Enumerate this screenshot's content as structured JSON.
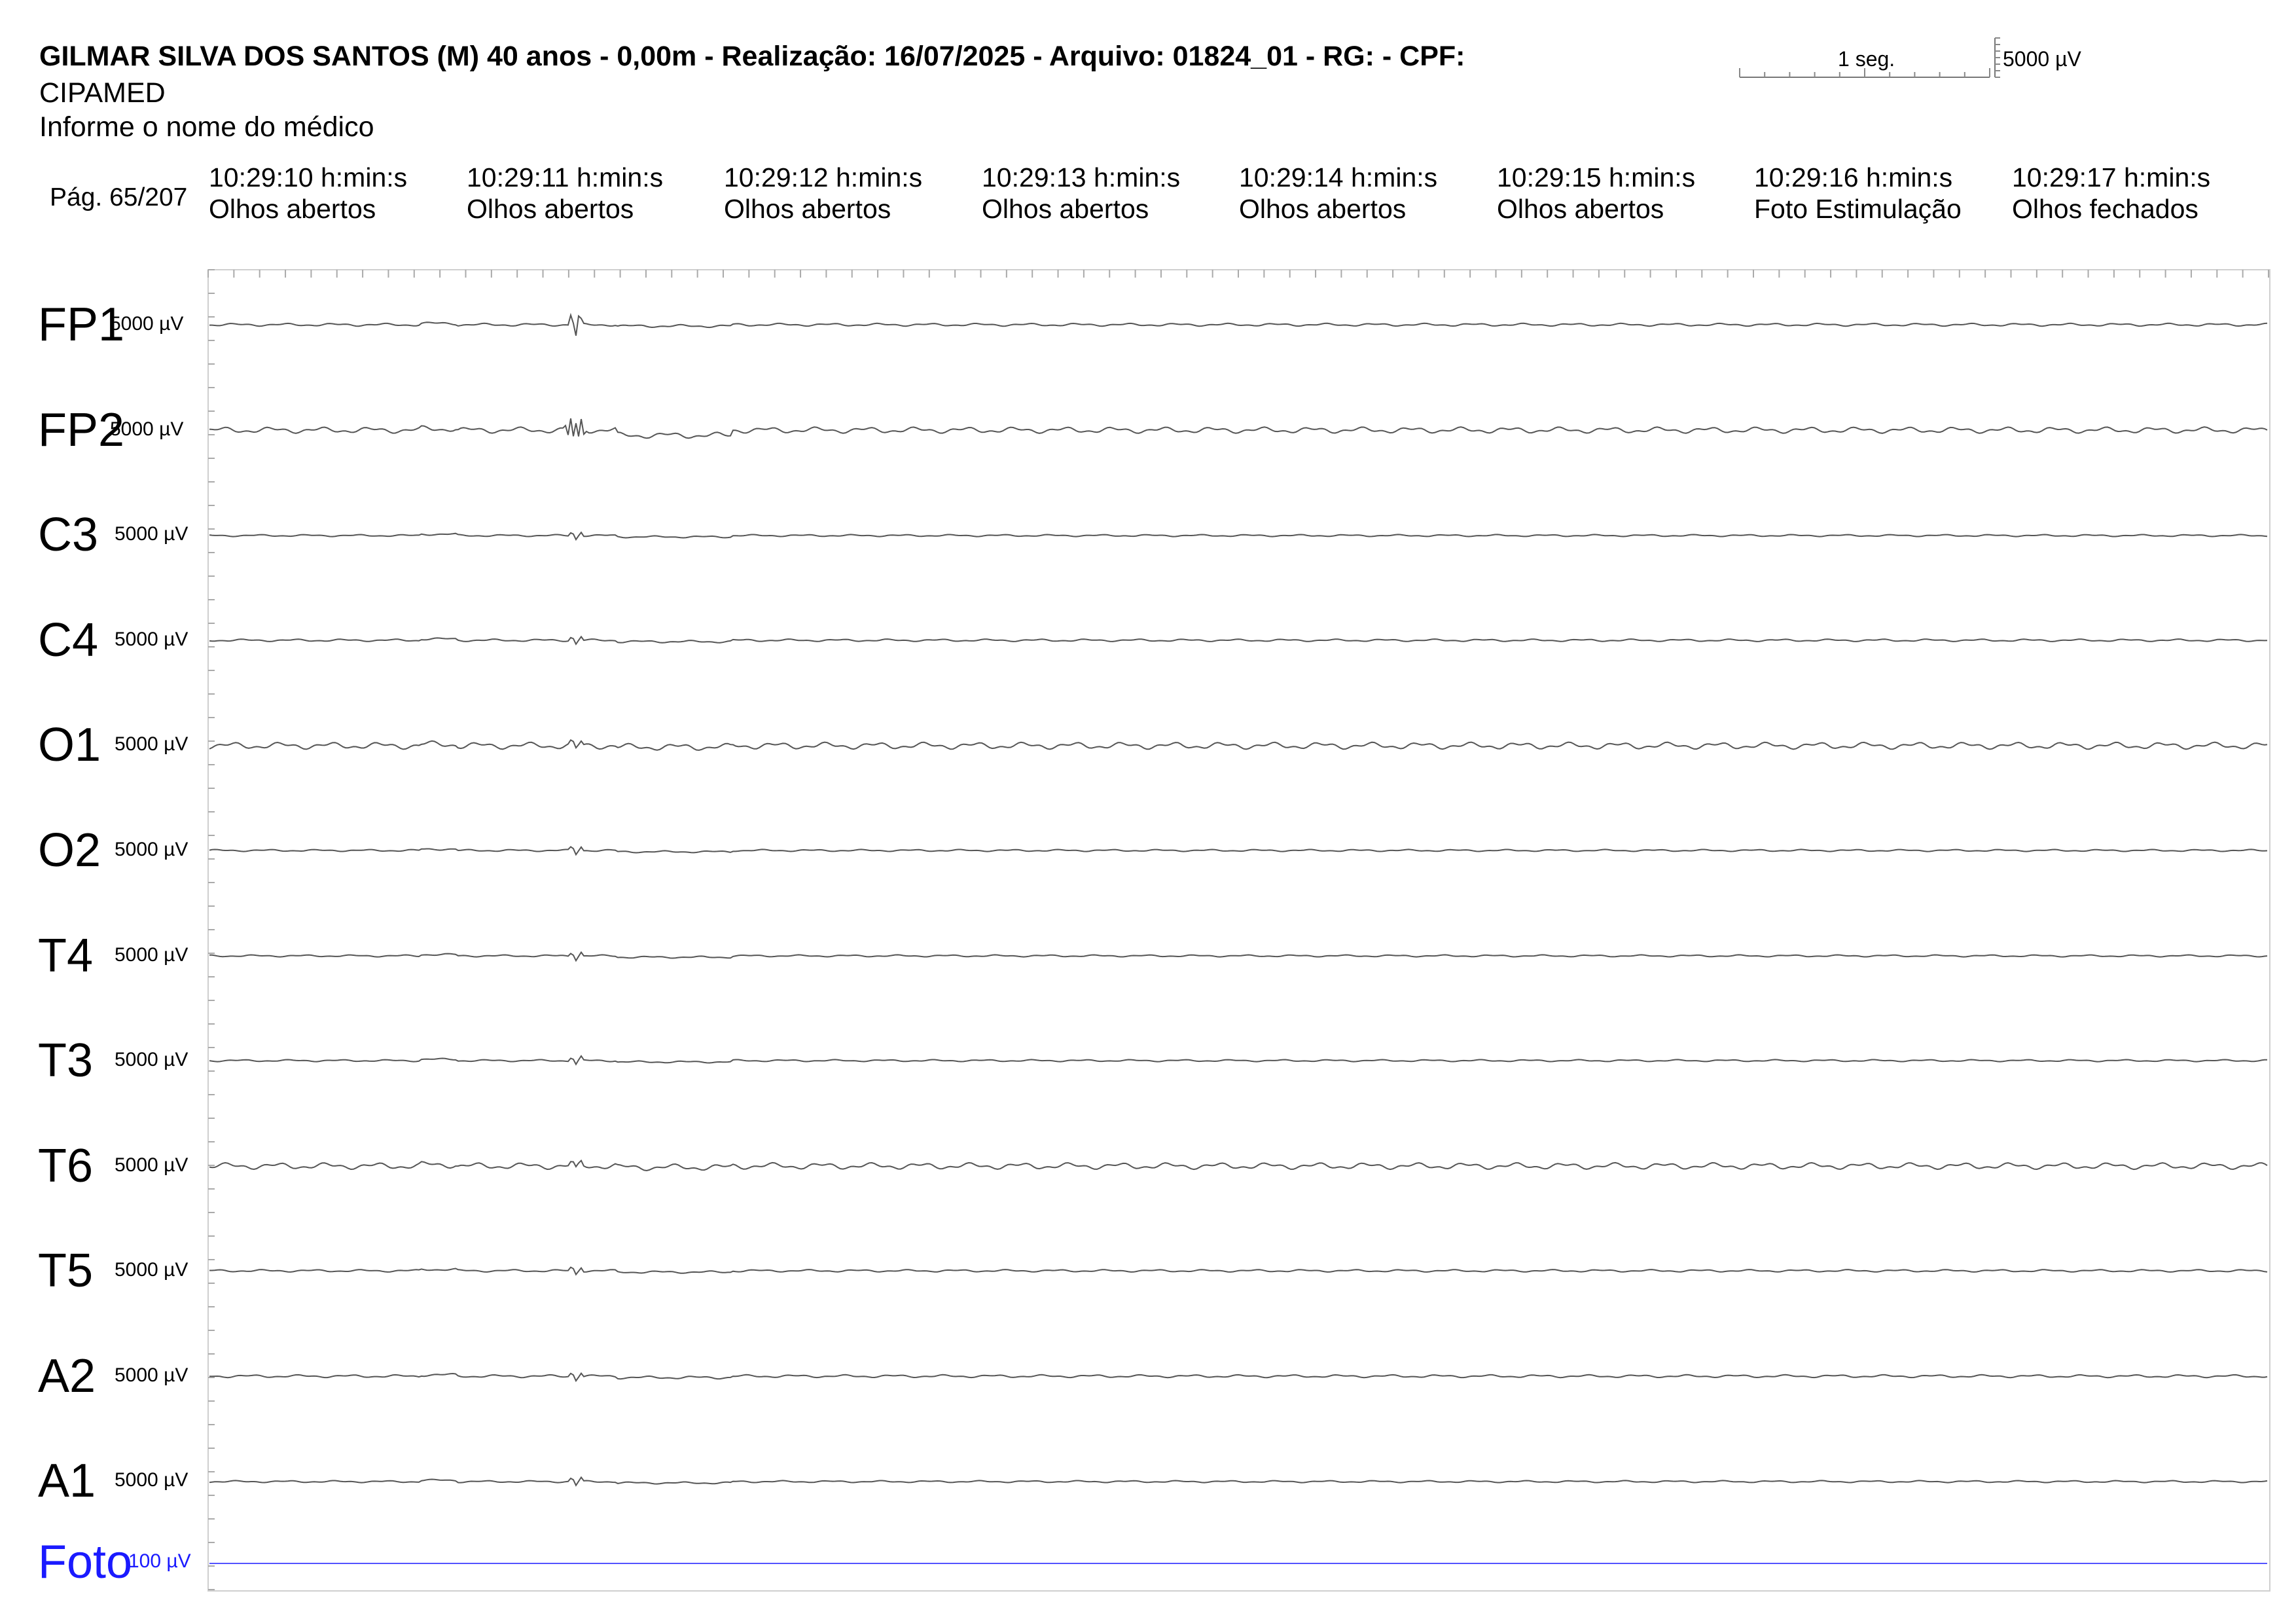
{
  "header": {
    "patient_line": "GILMAR SILVA DOS SANTOS (M) 40 anos - 0,00m - Realização: 16/07/2025 - Arquivo: 01824_01 - RG:  - CPF:",
    "clinic": "CIPAMED",
    "doctor": "Informe o nome do médico",
    "page_label": "Pág. 65/207"
  },
  "scale": {
    "time_label": "1 seg.",
    "amplitude_label": "5000 µV"
  },
  "segments": [
    {
      "time": "10:29:10 h:min:s",
      "state": "Olhos abertos"
    },
    {
      "time": "10:29:11 h:min:s",
      "state": "Olhos abertos"
    },
    {
      "time": "10:29:12 h:min:s",
      "state": "Olhos abertos"
    },
    {
      "time": "10:29:13 h:min:s",
      "state": "Olhos abertos"
    },
    {
      "time": "10:29:14 h:min:s",
      "state": "Olhos abertos"
    },
    {
      "time": "10:29:15 h:min:s",
      "state": "Olhos abertos"
    },
    {
      "time": "10:29:16 h:min:s",
      "state": "Foto Estimulação"
    },
    {
      "time": "10:29:17 h:min:s",
      "state": "Olhos fechados"
    }
  ],
  "channels": [
    {
      "name": "FP1",
      "sensitivity": "5000 µV",
      "color": "#555555"
    },
    {
      "name": "FP2",
      "sensitivity": "5000 µV",
      "color": "#555555"
    },
    {
      "name": "C3",
      "sensitivity": "5000 µV",
      "color": "#555555"
    },
    {
      "name": "C4",
      "sensitivity": "5000 µV",
      "color": "#555555"
    },
    {
      "name": "O1",
      "sensitivity": "5000 µV",
      "color": "#555555"
    },
    {
      "name": "O2",
      "sensitivity": "5000 µV",
      "color": "#555555"
    },
    {
      "name": "T4",
      "sensitivity": "5000 µV",
      "color": "#555555"
    },
    {
      "name": "T3",
      "sensitivity": "5000 µV",
      "color": "#555555"
    },
    {
      "name": "T6",
      "sensitivity": "5000 µV",
      "color": "#555555"
    },
    {
      "name": "T5",
      "sensitivity": "5000 µV",
      "color": "#555555"
    },
    {
      "name": "A2",
      "sensitivity": "5000 µV",
      "color": "#555555"
    },
    {
      "name": "A1",
      "sensitivity": "5000 µV",
      "color": "#555555"
    },
    {
      "name": "Foto",
      "sensitivity": "100 µV",
      "color": "#1a1aff"
    }
  ]
}
